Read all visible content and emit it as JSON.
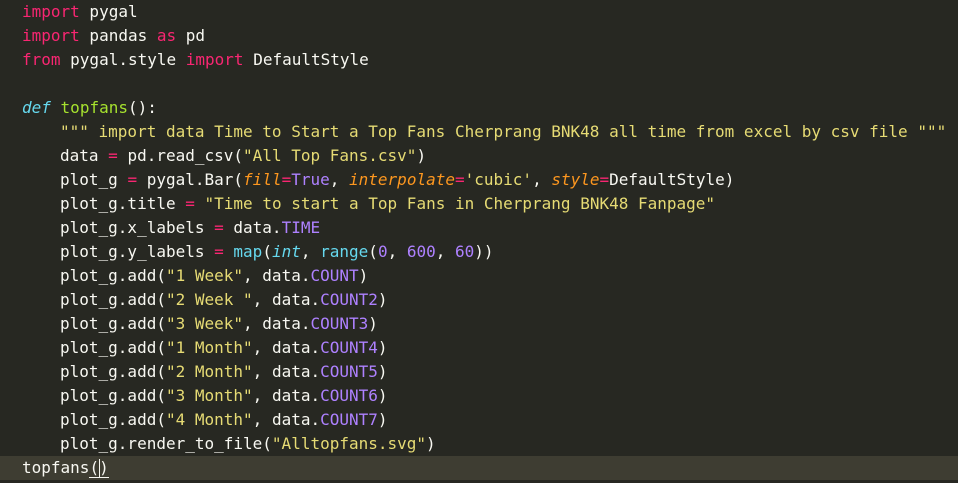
{
  "code": {
    "l1": {
      "t1": "import",
      "t2": " pygal"
    },
    "l2": {
      "t1": "import",
      "t2": " pandas ",
      "t3": "as",
      "t4": " pd"
    },
    "l3": {
      "t1": "from",
      "t2": " pygal.style ",
      "t3": "import",
      "t4": " DefaultStyle"
    },
    "l5": {
      "t1": "def",
      "t2": " ",
      "t3": "topfans",
      "t4": "():"
    },
    "l6": {
      "t1": "\"\"\" import data Time to Start a Top Fans Cherprang BNK48 all time from excel by csv file \"\"\""
    },
    "l7": {
      "t1": "data ",
      "t2": "=",
      "t3": " pd.read_csv(",
      "t4": "\"All Top Fans.csv\"",
      "t5": ")"
    },
    "l8": {
      "t1": "plot_g ",
      "t2": "=",
      "t3": " pygal.Bar(",
      "t4": "fill",
      "t5": "=",
      "t6": "True",
      "t7": ", ",
      "t8": "interpolate",
      "t9": "=",
      "t10": "'cubic'",
      "t11": ", ",
      "t12": "style",
      "t13": "=",
      "t14": "DefaultStyle)"
    },
    "l9": {
      "t1": "plot_g.title ",
      "t2": "=",
      "t3": " ",
      "t4": "\"Time to start a Top Fans in Cherprang BNK48 Fanpage\""
    },
    "l10": {
      "t1": "plot_g.x_labels ",
      "t2": "=",
      "t3": " data.",
      "t4": "TIME"
    },
    "l11": {
      "t1": "plot_g.y_labels ",
      "t2": "=",
      "t3": " ",
      "t4": "map",
      "t5": "(",
      "t6": "int",
      "t7": ", ",
      "t8": "range",
      "t9": "(",
      "t10": "0",
      "t11": ", ",
      "t12": "600",
      "t13": ", ",
      "t14": "60",
      "t15": "))"
    },
    "add_lines": [
      {
        "label": "\"1 Week\"",
        "field": "COUNT"
      },
      {
        "label": "\"2 Week \"",
        "field": "COUNT2"
      },
      {
        "label": "\"3 Week\"",
        "field": "COUNT3"
      },
      {
        "label": "\"1 Month\"",
        "field": "COUNT4"
      },
      {
        "label": "\"2 Month\"",
        "field": "COUNT5"
      },
      {
        "label": "\"3 Month\"",
        "field": "COUNT6"
      },
      {
        "label": "\"4 Month\"",
        "field": "COUNT7"
      }
    ],
    "add_prefix": "plot_g.add(",
    "add_mid": ", data.",
    "add_suffix": ")",
    "l19": {
      "t1": "plot_g.render_to_file(",
      "t2": "\"Alltopfans.svg\"",
      "t3": ")"
    },
    "l20": {
      "t1": "topfans",
      "t2": "(",
      "t3": ")"
    }
  },
  "colors": {
    "background": "#272822",
    "keyword": "#f92672",
    "function": "#a6e22e",
    "string": "#e6db74",
    "number": "#ae81ff",
    "builtin": "#66d9ef",
    "parameter": "#fd971f",
    "active_line": "#3e3d32"
  }
}
